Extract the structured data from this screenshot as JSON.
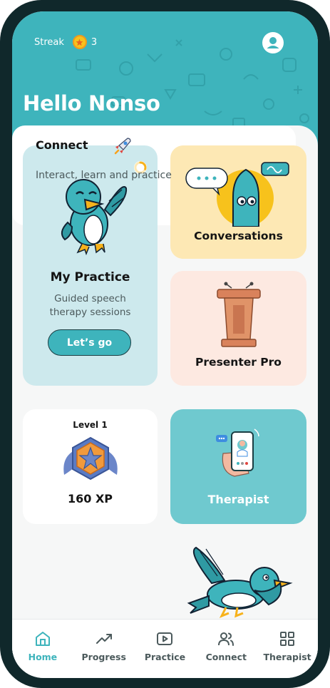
{
  "header": {
    "streak_label": "Streak",
    "streak_count": "3",
    "greeting": "Hello Nonso"
  },
  "cards": {
    "practice": {
      "title": "My Practice",
      "subtitle": "Guided speech therapy sessions",
      "button": "Let’s go",
      "progress": 0.3
    },
    "conversations": {
      "title": "Conversations"
    },
    "presenter": {
      "title": "Presenter Pro"
    },
    "level": {
      "label": "Level 1",
      "xp": "160 XP"
    },
    "therapist": {
      "title": "Therapist"
    },
    "connect": {
      "title": "Connect",
      "subtitle": "Interact, learn and practice"
    }
  },
  "nav": {
    "items": [
      {
        "label": "Home",
        "icon": "home-icon",
        "active": true
      },
      {
        "label": "Progress",
        "icon": "trend-up-icon"
      },
      {
        "label": "Practice",
        "icon": "play-icon"
      },
      {
        "label": "Connect",
        "icon": "users-icon"
      },
      {
        "label": "Therapist",
        "icon": "grid-icon"
      }
    ]
  },
  "colors": {
    "brand": "#3eb4bc",
    "frame": "#10282b",
    "practice_card": "#cde9ed",
    "conversations_card": "#fde8b4",
    "presenter_card": "#fde9e1",
    "therapist_card": "#6fc9cf",
    "coin": "#f7c21c"
  }
}
